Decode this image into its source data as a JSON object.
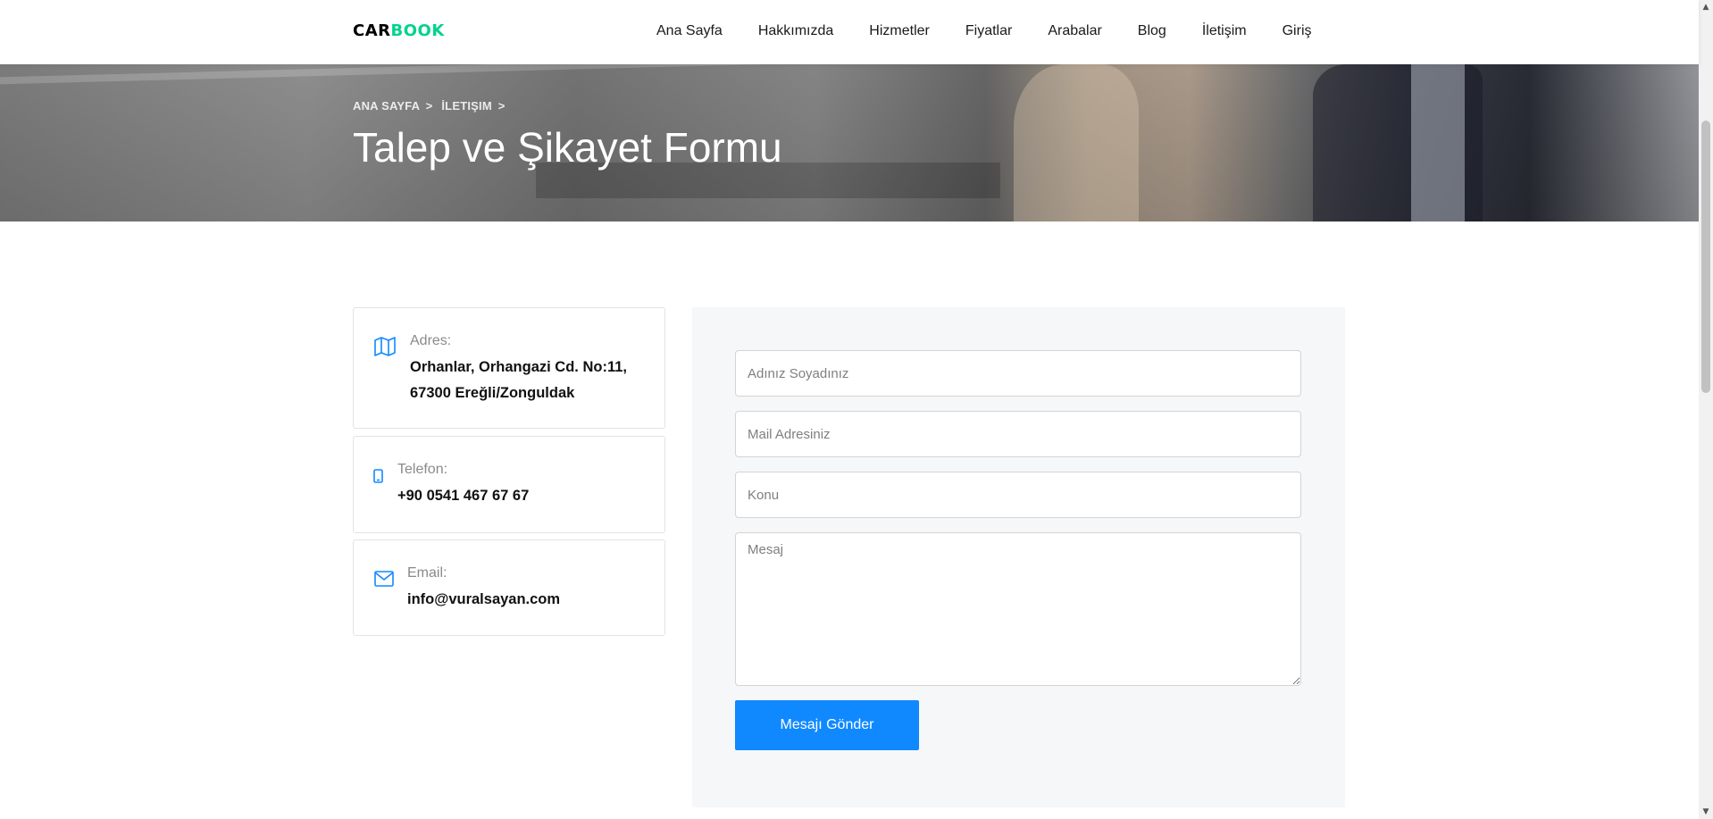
{
  "brand": {
    "part1": "CAR",
    "part2": "BOOK",
    "accent_color": "#01d28e"
  },
  "nav": {
    "items": [
      "Ana Sayfa",
      "Hakkımızda",
      "Hizmetler",
      "Fiyatlar",
      "Arabalar",
      "Blog",
      "İletişim",
      "Giriş"
    ]
  },
  "hero": {
    "breadcrumb": [
      {
        "label": "ANA SAYFA",
        "sep": ">"
      },
      {
        "label": "İLETIŞIM",
        "sep": ">"
      }
    ],
    "title": "Talep ve Şikayet Formu"
  },
  "contact": {
    "address": {
      "icon": "map-icon",
      "label": "Adres:",
      "value": "Orhanlar, Orhangazi Cd. No:11, 67300 Ereğli/Zonguldak"
    },
    "phone": {
      "icon": "phone-icon",
      "label": "Telefon:",
      "value": "+90 0541 467 67 67"
    },
    "email": {
      "icon": "envelope-icon",
      "label": "Email:",
      "value": "info@vuralsayan.com"
    }
  },
  "form": {
    "name_placeholder": "Adınız Soyadınız",
    "mail_placeholder": "Mail Adresiniz",
    "subject_placeholder": "Konu",
    "message_placeholder": "Mesaj",
    "submit_label": "Mesajı Gönder",
    "button_color": "#1089ff"
  },
  "colors": {
    "accent": "#1089ff",
    "panel_bg": "#f6f7f9"
  }
}
